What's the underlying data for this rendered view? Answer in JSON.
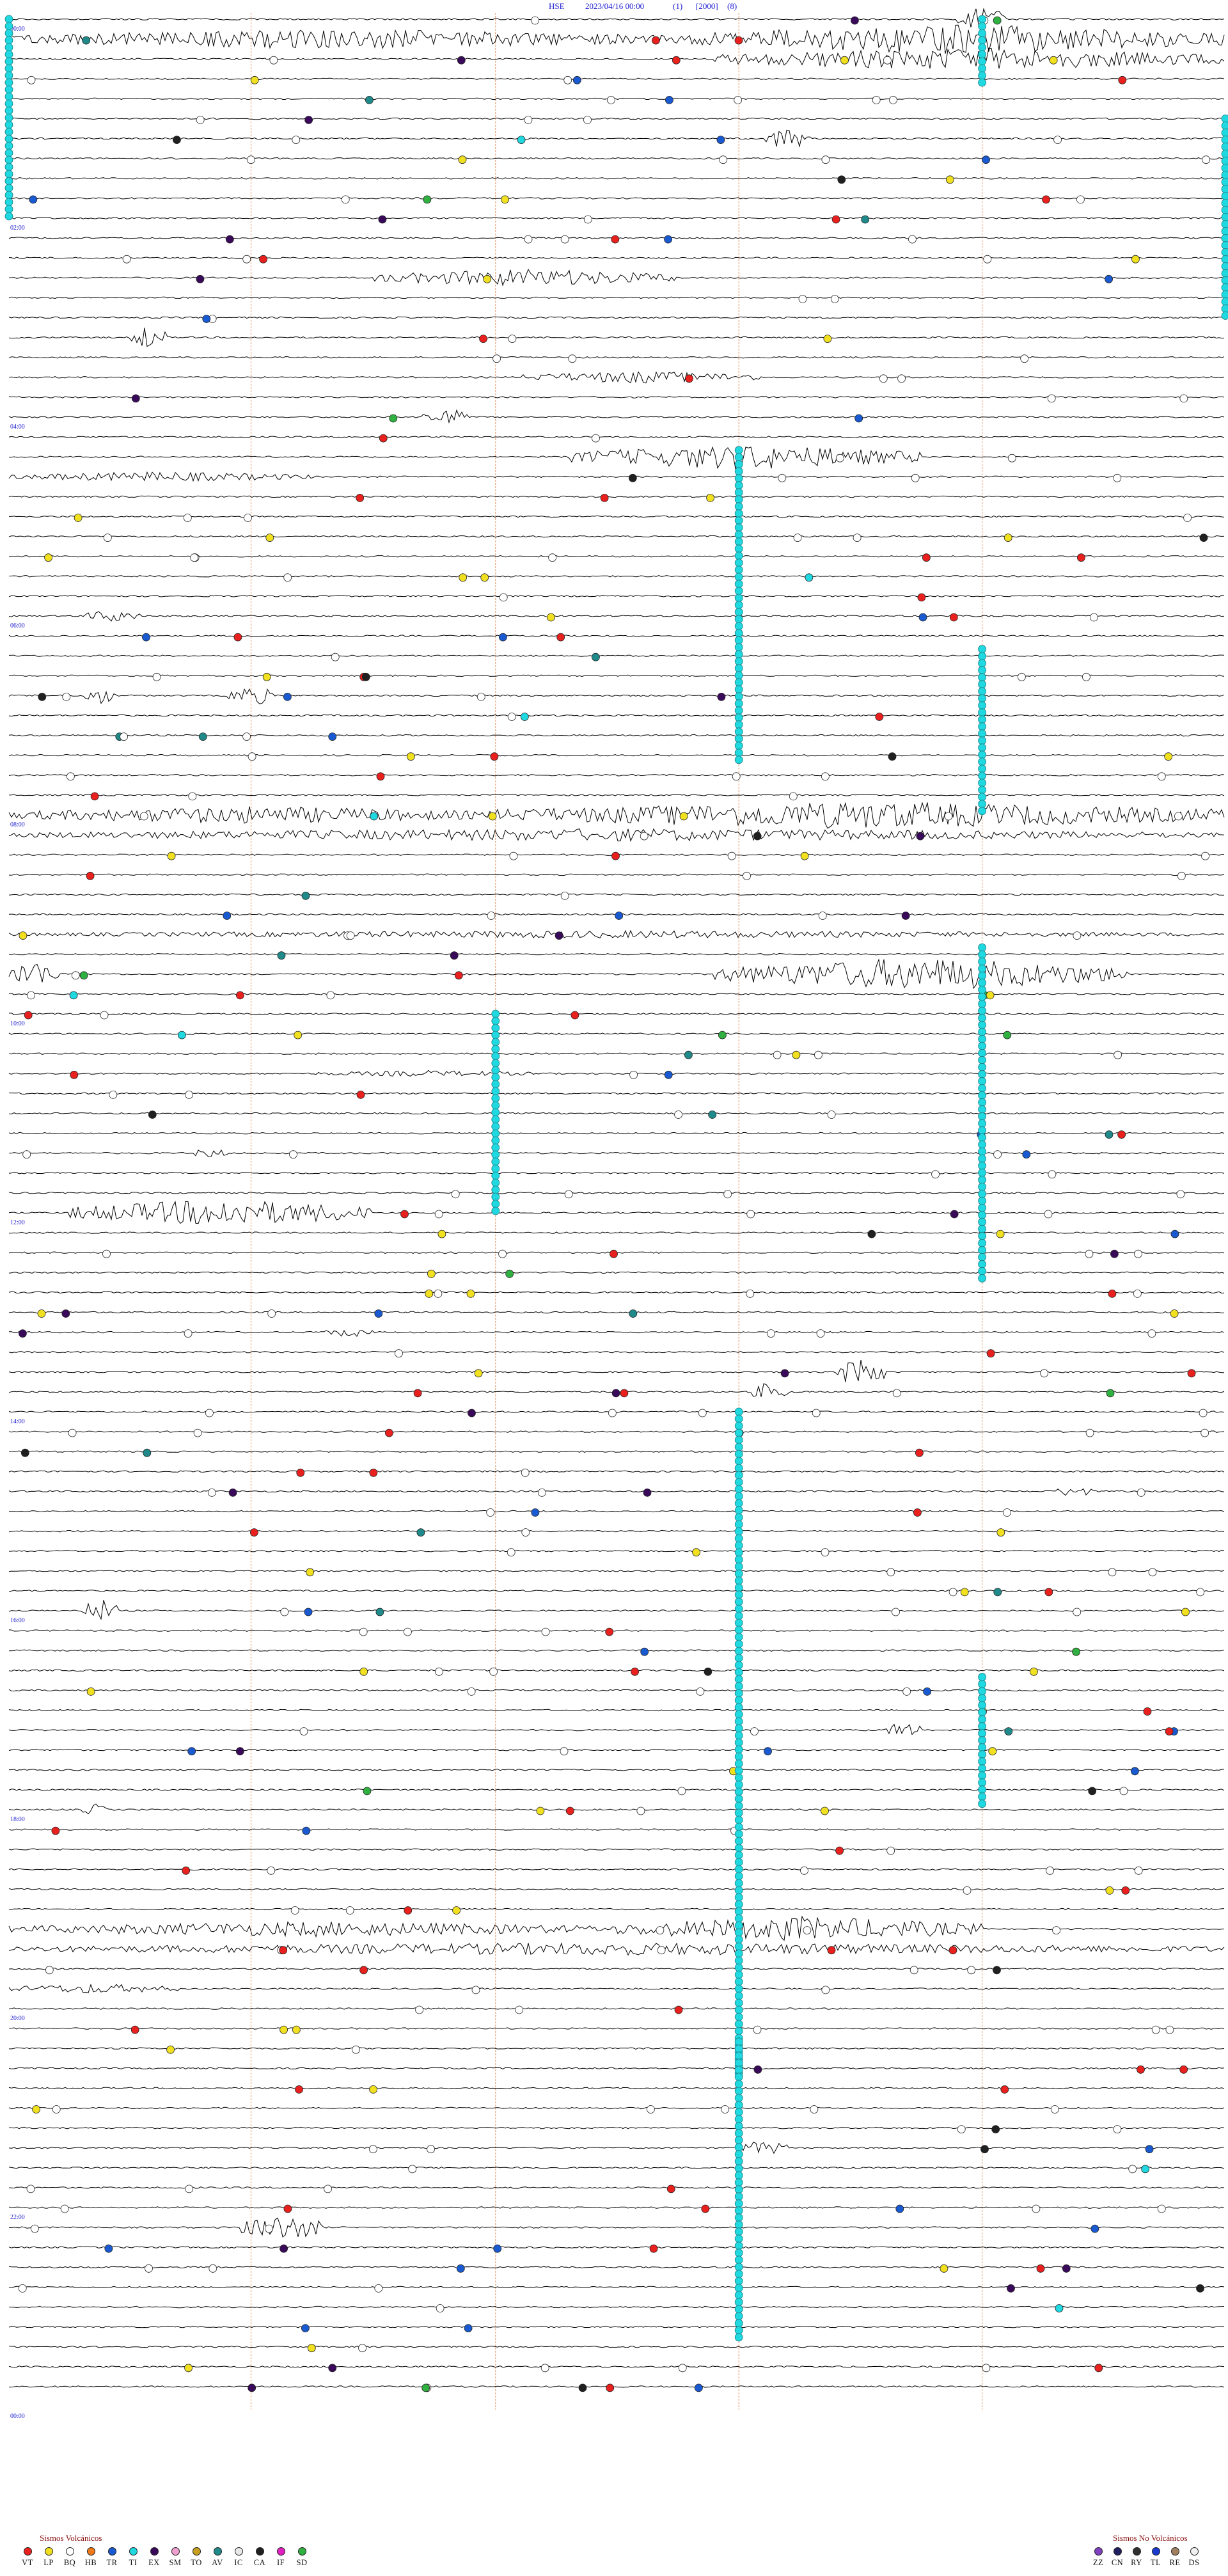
{
  "header": {
    "station": "HSE",
    "datetime": "2023/04/16 00:00",
    "channel": "(1)",
    "scale": "[2000]",
    "filter": "(8)"
  },
  "chart_data": {
    "type": "helicorder",
    "title": "HSE   2023/04/16 00:00",
    "hour_labels": [
      "00:00",
      "02:00",
      "04:00",
      "06:00",
      "08:00",
      "10:00",
      "12:00",
      "14:00",
      "16:00",
      "18:00",
      "20:00",
      "22:00",
      "00:00"
    ],
    "lines_total": 96,
    "minutes_per_line": 15,
    "colors": {
      "trace": "#000000",
      "time_label": "#1a1ad0",
      "marker_line": "#e07a3a",
      "VT": "#e8201e",
      "LP": "#f0e020",
      "BQ": "#ffffff",
      "HB": "#f07a1a",
      "TR": "#1a5ad0",
      "TI": "#20d8e0",
      "EX": "#3a0a5a",
      "SM": "#f0a0d0",
      "TO": "#c8a020",
      "AV": "#208a8a",
      "IC": "#e8e8e8",
      "CA": "#202020",
      "IF": "#e020c0",
      "SD": "#30b040",
      "ZZ": "#8040c0",
      "CN": "#202060",
      "RY": "#303030",
      "TL": "#1a3ad0",
      "RE": "#a08060",
      "DS": "#f0f0f0"
    }
  },
  "legend_volcanic": {
    "title": "Sismos Volcánicos",
    "items": [
      {
        "code": "VT",
        "color": "#e8201e"
      },
      {
        "code": "LP",
        "color": "#f0e020"
      },
      {
        "code": "BQ",
        "color": "#ffffff"
      },
      {
        "code": "HB",
        "color": "#f07a1a"
      },
      {
        "code": "TR",
        "color": "#1a5ad0"
      },
      {
        "code": "TI",
        "color": "#20d8e0"
      },
      {
        "code": "EX",
        "color": "#3a0a5a"
      },
      {
        "code": "SM",
        "color": "#f0a0d0"
      },
      {
        "code": "TO",
        "color": "#c8a020"
      },
      {
        "code": "AV",
        "color": "#208a8a"
      },
      {
        "code": "IC",
        "color": "#e8e8e8"
      },
      {
        "code": "CA",
        "color": "#202020"
      },
      {
        "code": "IF",
        "color": "#e020c0"
      },
      {
        "code": "SD",
        "color": "#30b040"
      }
    ]
  },
  "legend_nonvolcanic": {
    "title": "Sismos No Volcánicos",
    "items": [
      {
        "code": "ZZ",
        "color": "#8040c0"
      },
      {
        "code": "CN",
        "color": "#202060"
      },
      {
        "code": "RY",
        "color": "#303030"
      },
      {
        "code": "TL",
        "color": "#1a3ad0"
      },
      {
        "code": "RE",
        "color": "#a08060"
      },
      {
        "code": "DS",
        "color": "#f0f0f0"
      }
    ]
  }
}
